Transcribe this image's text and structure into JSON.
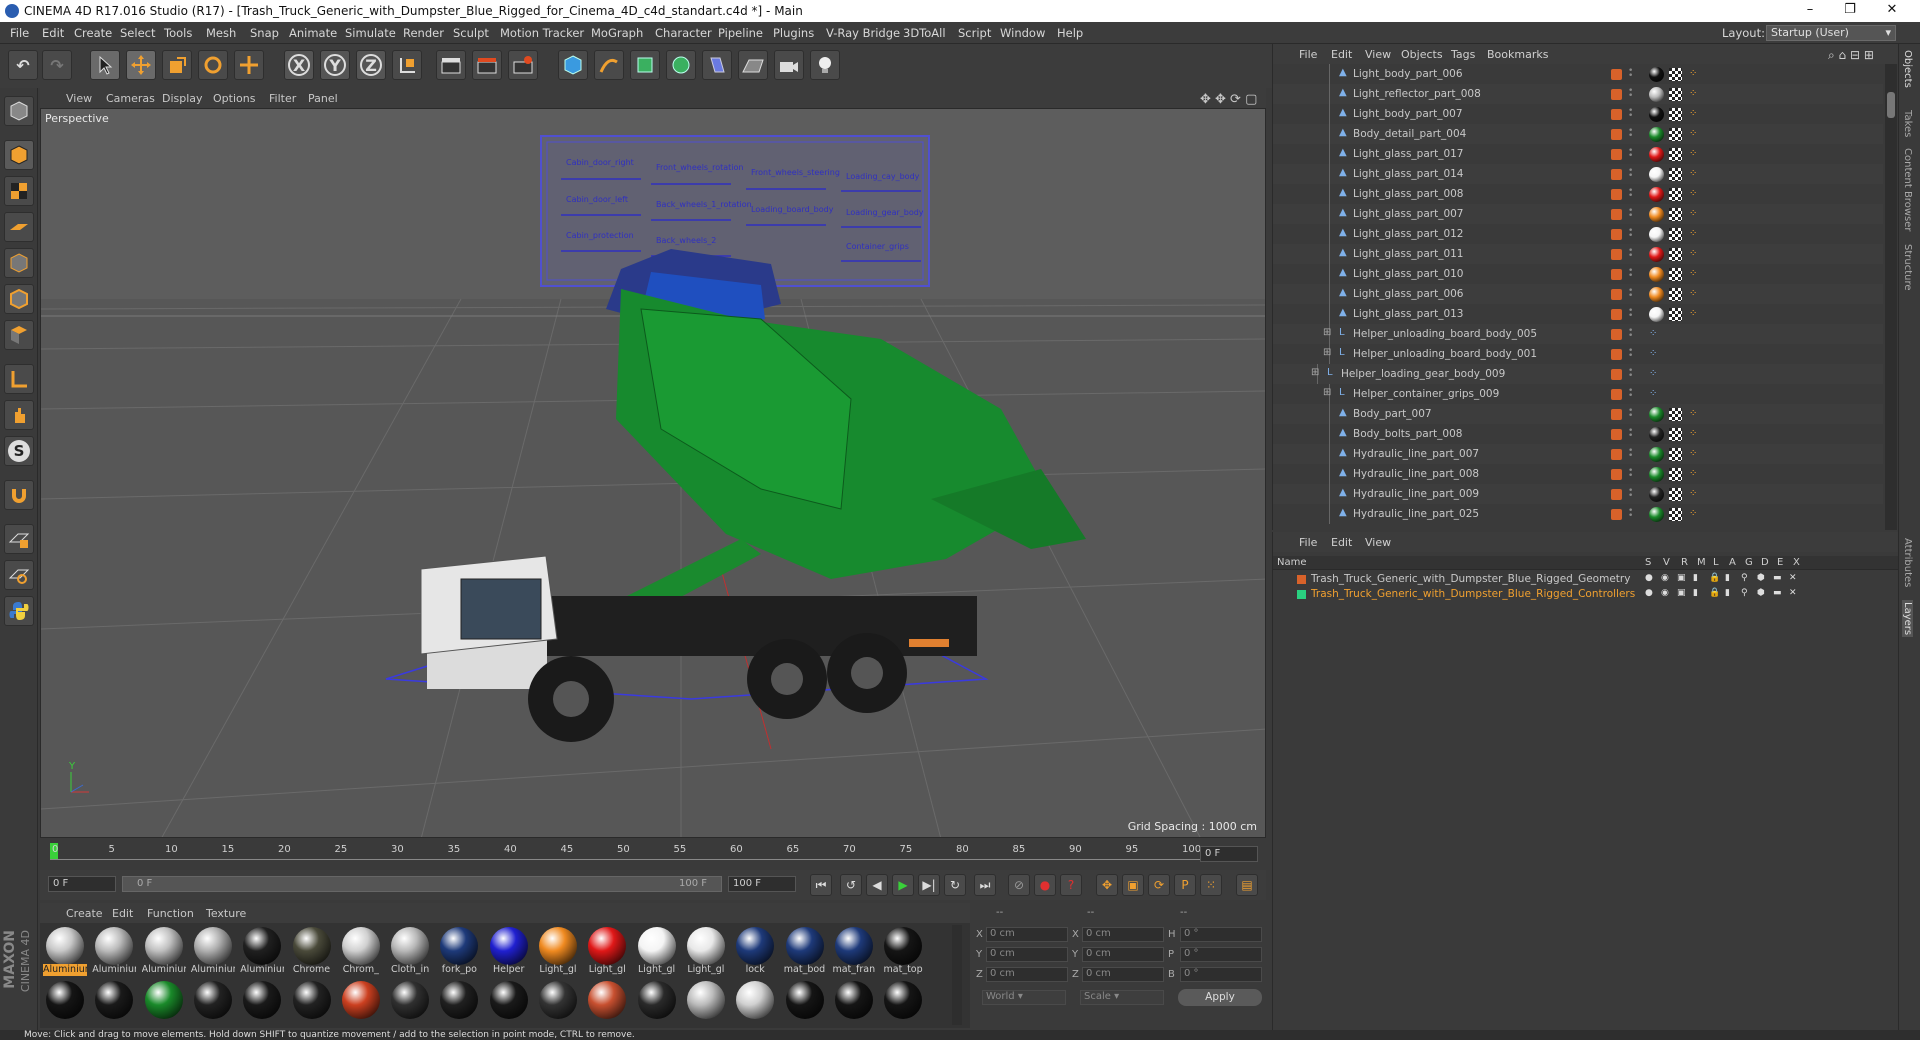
{
  "window": {
    "title": "CINEMA 4D R17.016 Studio (R17) - [Trash_Truck_Generic_with_Dumpster_Blue_Rigged_for_Cinema_4D_c4d_standart.c4d *] - Main",
    "minimize": "–",
    "restore": "❐",
    "close": "✕"
  },
  "menubar": [
    "File",
    "Edit",
    "Create",
    "Select",
    "Tools",
    "Mesh",
    "Snap",
    "Animate",
    "Simulate",
    "Render",
    "Sculpt",
    "Motion Tracker",
    "MoGraph",
    "Character",
    "Pipeline",
    "Plugins",
    "V-Ray Bridge",
    "3DToAll",
    "Script",
    "Window",
    "Help"
  ],
  "layout": {
    "label": "Layout:",
    "value": "Startup (User)"
  },
  "toolbar": {
    "undo": "↶",
    "redo": "↷",
    "x": "X",
    "y": "Y",
    "z": "Z"
  },
  "viewport": {
    "menu": [
      "View",
      "Cameras",
      "Display",
      "Options",
      "Filter",
      "Panel"
    ],
    "label": "Perspective",
    "grid_spacing": "Grid Spacing : 1000 cm",
    "hud_labels": [
      "Cabin_door_right",
      "Front_wheels_rotation",
      "Front_wheels_steering",
      "Loading_cay_body",
      "Cabin_door_left",
      "Back_wheels_1_rotation",
      "Loading_board_body",
      "Loading_gear_body",
      "Cabin_protection",
      "Back_wheels_2",
      "Container_grips"
    ]
  },
  "timeline": {
    "ticks": [
      "0",
      "5",
      "10",
      "15",
      "20",
      "25",
      "30",
      "35",
      "40",
      "45",
      "50",
      "55",
      "60",
      "65",
      "70",
      "75",
      "80",
      "85",
      "90",
      "95",
      "100"
    ],
    "current": "0 F"
  },
  "transport": {
    "start": "0 F",
    "range_start": "0 F",
    "range_end": "100 F",
    "end": "100 F"
  },
  "materials": {
    "menu": [
      "Create",
      "Edit",
      "Function",
      "Texture"
    ],
    "row1": [
      {
        "name": "Aluminium",
        "color": "#c8c8c8",
        "selected": true
      },
      {
        "name": "Aluminium",
        "color": "#bbbbbb"
      },
      {
        "name": "Aluminium",
        "color": "#c0c0c0"
      },
      {
        "name": "Aluminium",
        "color": "#b0b0b0"
      },
      {
        "name": "Aluminium",
        "color": "#202020"
      },
      {
        "name": "Chrome",
        "color": "#4a4a3a"
      },
      {
        "name": "Chrom_",
        "color": "#d0d0d0"
      },
      {
        "name": "Cloth_in",
        "color": "#b8b8b8"
      },
      {
        "name": "fork_po",
        "color": "#1e3a7a"
      },
      {
        "name": "Helper",
        "color": "#2020d0"
      },
      {
        "name": "Light_gl",
        "color": "#f08a20"
      },
      {
        "name": "Light_gl",
        "color": "#e01818"
      },
      {
        "name": "Light_gl",
        "color": "#f4f4f4"
      },
      {
        "name": "Light_gl",
        "color": "#e8e8e8"
      },
      {
        "name": "lock",
        "color": "#1e3a7a"
      },
      {
        "name": "mat_bod",
        "color": "#1e3a7a"
      },
      {
        "name": "mat_fran",
        "color": "#1e3a7a"
      },
      {
        "name": "mat_top",
        "color": "#151515"
      }
    ],
    "row2": [
      "#151515",
      "#1a1a1a",
      "#1a8a2a",
      "#222",
      "#1a1a1a",
      "#222",
      "#cc4020",
      "#303030",
      "#202020",
      "#1a1a1a",
      "#333",
      "#c85030",
      "#2a2a2a",
      "#bbbbbb",
      "#d0d0d0",
      "#151515",
      "#151515",
      "#151515"
    ]
  },
  "coords": {
    "headers": [
      "--",
      "--",
      "--"
    ],
    "labels": [
      "X",
      "Y",
      "Z"
    ],
    "pos": [
      "0 cm",
      "0 cm",
      "0 cm"
    ],
    "labels2": [
      "X",
      "Y",
      "Z"
    ],
    "size": [
      "0 cm",
      "0 cm",
      "0 cm"
    ],
    "labels3": [
      "H",
      "P",
      "B"
    ],
    "rot": [
      "0 °",
      "0 °",
      "0 °"
    ],
    "world": "World",
    "scale": "Scale",
    "apply": "Apply"
  },
  "objects": {
    "menu": [
      "File",
      "Edit",
      "View",
      "Objects",
      "Tags",
      "Bookmarks"
    ],
    "items": [
      {
        "name": "Light_body_part_006",
        "indent": 1,
        "mat": "#111",
        "type": "mesh"
      },
      {
        "name": "Light_reflector_part_008",
        "indent": 1,
        "mat": "#bbbbbb",
        "type": "mesh"
      },
      {
        "name": "Light_body_part_007",
        "indent": 1,
        "mat": "#111",
        "type": "mesh"
      },
      {
        "name": "Body_detail_part_004",
        "indent": 1,
        "mat": "#1a8a2a",
        "type": "mesh"
      },
      {
        "name": "Light_glass_part_017",
        "indent": 1,
        "mat": "#e01818",
        "type": "mesh"
      },
      {
        "name": "Light_glass_part_014",
        "indent": 1,
        "mat": "#f4f4f4",
        "type": "mesh"
      },
      {
        "name": "Light_glass_part_008",
        "indent": 1,
        "mat": "#e01818",
        "type": "mesh"
      },
      {
        "name": "Light_glass_part_007",
        "indent": 1,
        "mat": "#f08a20",
        "type": "mesh"
      },
      {
        "name": "Light_glass_part_012",
        "indent": 1,
        "mat": "#f4f4f4",
        "type": "mesh"
      },
      {
        "name": "Light_glass_part_011",
        "indent": 1,
        "mat": "#e01818",
        "type": "mesh"
      },
      {
        "name": "Light_glass_part_010",
        "indent": 1,
        "mat": "#f08a20",
        "type": "mesh"
      },
      {
        "name": "Light_glass_part_006",
        "indent": 1,
        "mat": "#f08a20",
        "type": "mesh"
      },
      {
        "name": "Light_glass_part_013",
        "indent": 1,
        "mat": "#f4f4f4",
        "type": "mesh"
      },
      {
        "name": "Helper_unloading_board_body_005",
        "indent": 1,
        "mat": "",
        "type": "null"
      },
      {
        "name": "Helper_unloading_board_body_001",
        "indent": 1,
        "mat": "",
        "type": "null"
      },
      {
        "name": "Helper_loading_gear_body_009",
        "indent": 0,
        "mat": "",
        "type": "null"
      },
      {
        "name": "Helper_container_grips_009",
        "indent": 1,
        "mat": "",
        "type": "null"
      },
      {
        "name": "Body_part_007",
        "indent": 1,
        "mat": "#1a8a2a",
        "type": "mesh"
      },
      {
        "name": "Body_bolts_part_008",
        "indent": 1,
        "mat": "#222",
        "type": "mesh"
      },
      {
        "name": "Hydraulic_line_part_007",
        "indent": 1,
        "mat": "#1a8a2a",
        "type": "mesh"
      },
      {
        "name": "Hydraulic_line_part_008",
        "indent": 1,
        "mat": "#1a8a2a",
        "type": "mesh"
      },
      {
        "name": "Hydraulic_line_part_009",
        "indent": 1,
        "mat": "#222",
        "type": "mesh"
      },
      {
        "name": "Hydraulic_line_part_025",
        "indent": 1,
        "mat": "#1a8a2a",
        "type": "mesh"
      }
    ]
  },
  "layers": {
    "menu": [
      "File",
      "Edit",
      "View"
    ],
    "headers": [
      "Name",
      "S",
      "V",
      "R",
      "M",
      "L",
      "A",
      "G",
      "D",
      "E",
      "X"
    ],
    "items": [
      {
        "name": "Trash_Truck_Generic_with_Dumpster_Blue_Rigged_Geometry",
        "color": "#d8622a",
        "text": "#c8c8c8"
      },
      {
        "name": "Trash_Truck_Generic_with_Dumpster_Blue_Rigged_Controllers",
        "color": "#2ad080",
        "text": "#f0a030"
      }
    ]
  },
  "right_tabs": [
    "Objects",
    "Takes",
    "Content Browser",
    "Structure",
    "Attributes",
    "Layers"
  ],
  "status": "Move: Click and drag to move elements. Hold down SHIFT to quantize movement / add to the selection in point mode, CTRL to remove.",
  "brand": {
    "maxon": "MAXON",
    "c4d": "CINEMA 4D"
  }
}
